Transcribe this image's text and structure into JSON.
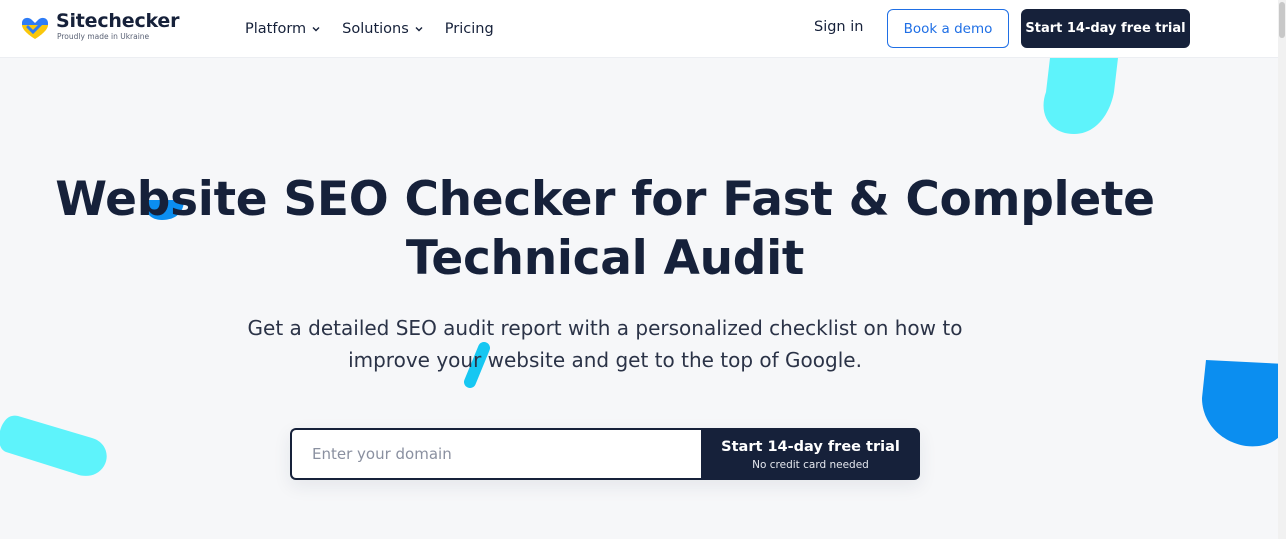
{
  "brand": {
    "name": "Sitechecker",
    "tagline": "Proudly made in Ukraine"
  },
  "nav": {
    "items": [
      {
        "label": "Platform",
        "has_dropdown": true
      },
      {
        "label": "Solutions",
        "has_dropdown": true
      },
      {
        "label": "Pricing",
        "has_dropdown": false
      }
    ],
    "sign_in": "Sign in",
    "book_demo": "Book a demo",
    "start_trial": "Start 14-day free trial"
  },
  "hero": {
    "title_line1": "Website SEO Checker for Fast & Complete",
    "title_line2": "Technical Audit",
    "subtitle_line1": "Get a detailed SEO audit report with a personalized checklist on how to",
    "subtitle_line2": "improve your website and get to the top of Google."
  },
  "form": {
    "domain_placeholder": "Enter your domain",
    "domain_value": "",
    "submit_label": "Start 14-day free trial",
    "submit_note": "No credit card needed"
  },
  "colors": {
    "navy": "#16213a",
    "accent_blue": "#1f6fe5",
    "cyan": "#5ef3fb",
    "bright_blue": "#0b8ef0",
    "logo_yellow": "#f9c70c",
    "background": "#f6f7f9"
  },
  "icons": {
    "logo": "sitechecker-heart-check-logo",
    "dropdown": "chevron-down-icon"
  }
}
